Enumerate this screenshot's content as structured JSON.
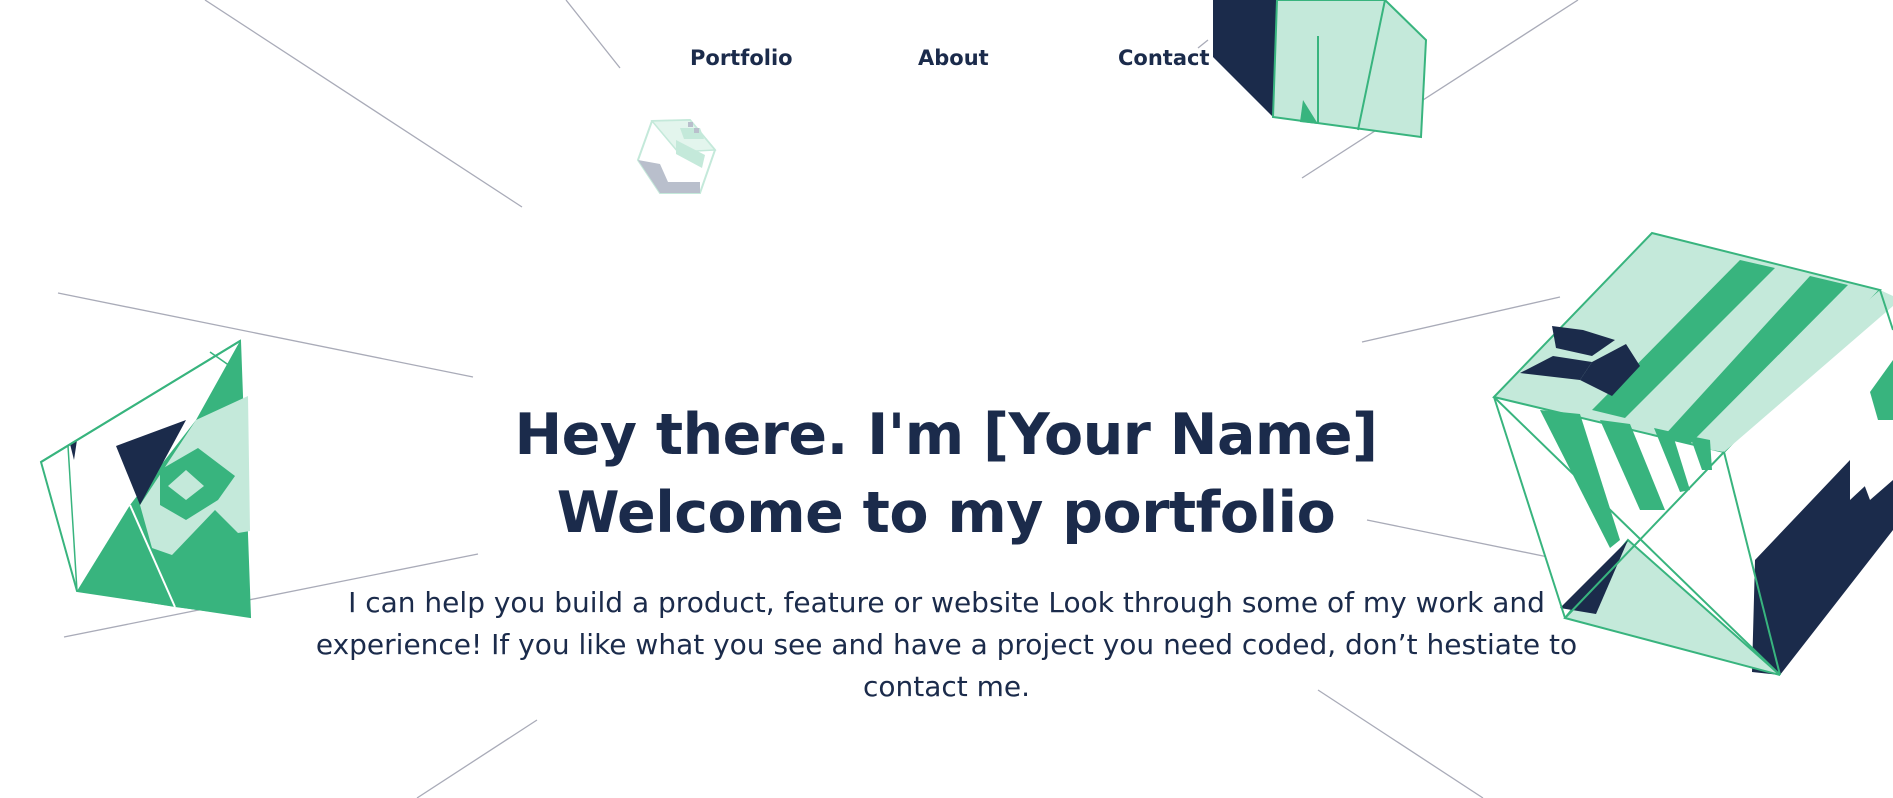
{
  "nav": {
    "items": [
      {
        "label": "Portfolio"
      },
      {
        "label": "About"
      },
      {
        "label": "Contact"
      }
    ]
  },
  "hero": {
    "title_line_1": "Hey there. I'm [Your Name]",
    "title_line_2": "Welcome to my portfolio",
    "text": "I can help you build a product, feature or website Look through some of my work and experience! If you like what you see and have a project you need coded, don’t hestiate to contact me."
  },
  "colors": {
    "navy": "#1b2b4b",
    "green": "#38b47e",
    "mint": "#c4e9da",
    "line_gray": "#a9abb8"
  }
}
